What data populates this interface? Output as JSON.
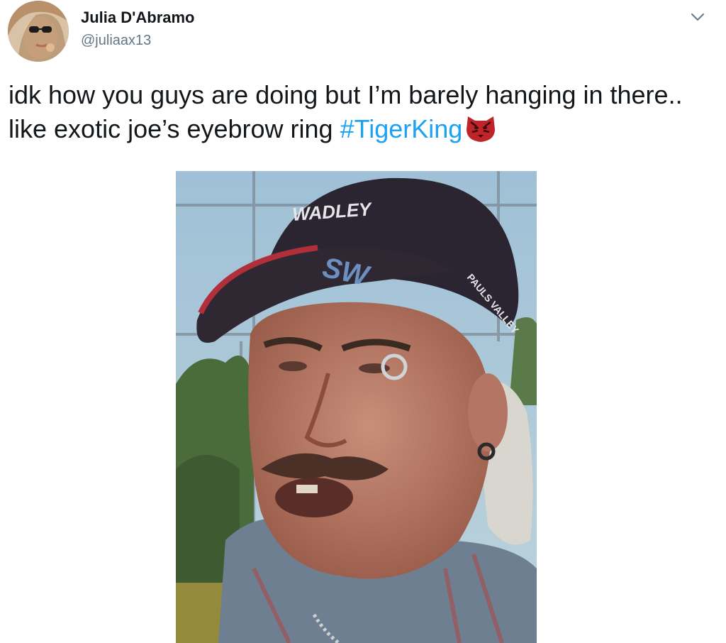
{
  "author": {
    "name": "Julia D'Abramo",
    "handle": "@juliaax13",
    "avatar_icon": "profile-photo"
  },
  "tweet": {
    "text_before": "idk how you guys are doing but I’m barely hanging in there.. like exotic joe’s eyebrow ring ",
    "hashtag": "#TigerKing",
    "emoji_icon": "tiger-face-emoji"
  },
  "media": {
    "cap_text_top": "WADLEY",
    "cap_logo": "SW",
    "cap_side_text": "PAULS VALLEY"
  },
  "colors": {
    "hashtag": "#1da1f2",
    "handle": "#657786",
    "name": "#14171a"
  }
}
